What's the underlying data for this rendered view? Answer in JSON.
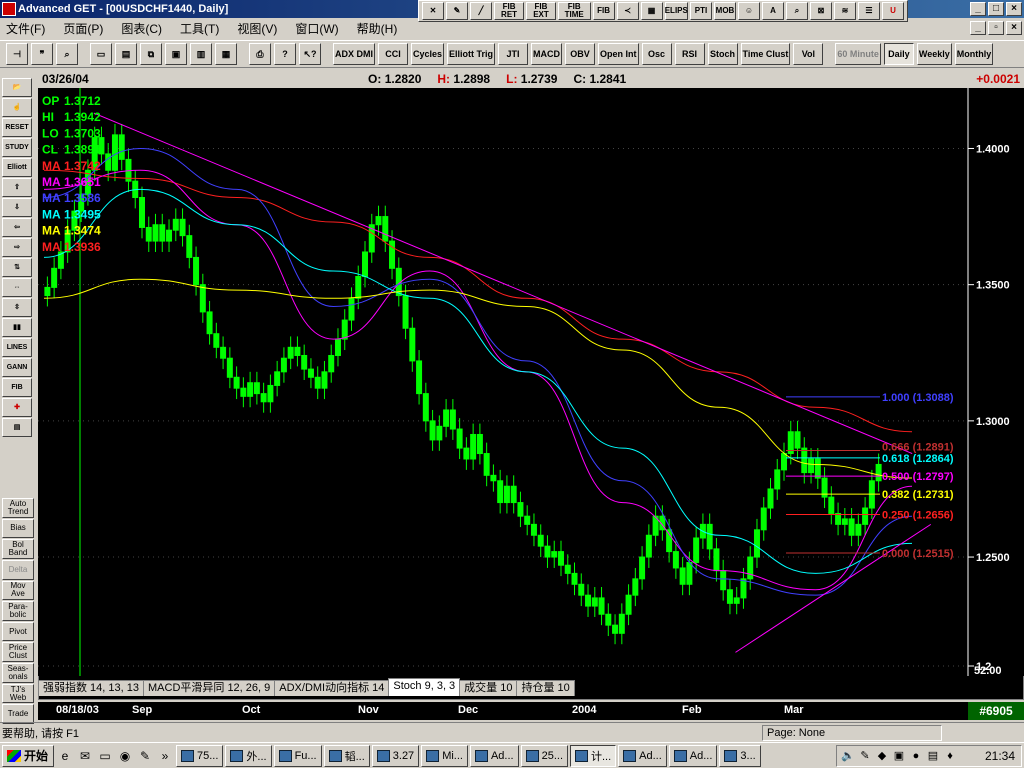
{
  "window": {
    "title": "Advanced GET - [00USDCHF1440, Daily]"
  },
  "menu": [
    "文件(F)",
    "页面(P)",
    "图表(C)",
    "工具(T)",
    "视图(V)",
    "窗口(W)",
    "帮助(H)"
  ],
  "floatbar": [
    "FIB RET",
    "FIB EXT",
    "FIB TIME",
    "FIB",
    "ELIPS",
    "PTI",
    "MOB",
    "A"
  ],
  "toolbar": {
    "studies": [
      "ADX DMI",
      "CCI",
      "Cycles",
      "Elliott Trig",
      "JTI",
      "MACD",
      "OBV",
      "Open Int",
      "Osc",
      "RSI",
      "Stoch",
      "Time Clust",
      "Vol"
    ],
    "periods": [
      "60 Minute",
      "Daily",
      "Weekly",
      "Monthly"
    ]
  },
  "palette": [
    "RESET",
    "STUDY",
    "Elliott",
    "LINES",
    "GANN",
    "FIB"
  ],
  "palette2": [
    "Auto Trend",
    "Bias",
    "Bol Band",
    "Delta",
    "Mov Ave",
    "Para-bolic",
    "Pivot",
    "Price Clust",
    "Seas-onals",
    "TJ's Web",
    "Trade"
  ],
  "info": {
    "date": "03/26/04",
    "o_label": "O:",
    "o": "1.2820",
    "h_label": "H:",
    "h": "1.2898",
    "l_label": "L:",
    "l": "1.2739",
    "c_label": "C:",
    "c": "1.2841",
    "change": "+0.0021"
  },
  "legend": [
    {
      "label": "OP",
      "value": "1.3712",
      "color": "#00ff00"
    },
    {
      "label": "HI",
      "value": "1.3942",
      "color": "#00ff00"
    },
    {
      "label": "LO",
      "value": "1.3703",
      "color": "#00ff00"
    },
    {
      "label": "CL",
      "value": "1.3891",
      "color": "#00ff00"
    },
    {
      "label": "MA",
      "value": "1.3742",
      "color": "#ff2020"
    },
    {
      "label": "MA",
      "value": "1.3651",
      "color": "#ff00ff"
    },
    {
      "label": "MA",
      "value": "1.3586",
      "color": "#4040ff"
    },
    {
      "label": "MA",
      "value": "1.3495",
      "color": "#00ffff"
    },
    {
      "label": "MA",
      "value": "1.3474",
      "color": "#ffff00"
    },
    {
      "label": "MA",
      "value": "1.3936",
      "color": "#ff2020"
    }
  ],
  "fib_levels": [
    {
      "ratio": "1.000",
      "price": 1.3088,
      "text": "1.000 (1.3088)",
      "color": "#4040ff"
    },
    {
      "ratio": "0.618",
      "price": 1.2864,
      "text": "0.618 (1.2864)",
      "color": "#00ffff"
    },
    {
      "ratio": "0.500",
      "price": 1.2797,
      "text": "0.500 (1.2797)",
      "color": "#ff00ff"
    },
    {
      "ratio": "0.382",
      "price": 1.2731,
      "text": "0.382 (1.2731)",
      "color": "#ffff00"
    },
    {
      "ratio": "0.250",
      "price": 1.2656,
      "text": "0.250 (1.2656)",
      "color": "#ff2020"
    },
    {
      "ratio": "0.000",
      "price": 1.2515,
      "text": "0.000 (1.2515)",
      "color": "#c03030"
    }
  ],
  "fib_extra": {
    "ratio": "0.666",
    "price": 1.2891,
    "text": "0.666 (1.2891)",
    "color": "#c03030"
  },
  "chart_data": {
    "type": "candlestick",
    "y_ticks": [
      "1.4000",
      "1.3500",
      "1.3000",
      "1.2500",
      "1.2"
    ],
    "y_tick_values": [
      1.4,
      1.35,
      1.3,
      1.25,
      1.21
    ],
    "ylim": [
      1.21,
      1.42
    ],
    "x_labels": [
      "08/18/03",
      "Sep",
      "Oct",
      "Nov",
      "Dec",
      "2004",
      "Feb",
      "Mar"
    ],
    "closes": [
      1.349,
      1.356,
      1.362,
      1.37,
      1.377,
      1.383,
      1.392,
      1.404,
      1.398,
      1.392,
      1.405,
      1.396,
      1.388,
      1.382,
      1.371,
      1.366,
      1.372,
      1.366,
      1.37,
      1.374,
      1.368,
      1.36,
      1.35,
      1.34,
      1.332,
      1.327,
      1.323,
      1.316,
      1.312,
      1.309,
      1.314,
      1.31,
      1.307,
      1.313,
      1.318,
      1.323,
      1.327,
      1.324,
      1.319,
      1.316,
      1.312,
      1.318,
      1.324,
      1.33,
      1.337,
      1.345,
      1.353,
      1.362,
      1.372,
      1.375,
      1.366,
      1.356,
      1.346,
      1.334,
      1.322,
      1.31,
      1.3,
      1.293,
      1.298,
      1.304,
      1.297,
      1.29,
      1.286,
      1.295,
      1.288,
      1.28,
      1.278,
      1.27,
      1.276,
      1.27,
      1.265,
      1.262,
      1.258,
      1.254,
      1.25,
      1.252,
      1.247,
      1.244,
      1.24,
      1.236,
      1.232,
      1.235,
      1.229,
      1.225,
      1.222,
      1.229,
      1.236,
      1.242,
      1.25,
      1.258,
      1.265,
      1.26,
      1.252,
      1.246,
      1.24,
      1.248,
      1.257,
      1.262,
      1.253,
      1.245,
      1.238,
      1.233,
      1.235,
      1.242,
      1.25,
      1.26,
      1.268,
      1.275,
      1.282,
      1.288,
      1.296,
      1.29,
      1.281,
      1.286,
      1.279,
      1.272,
      1.266,
      1.262,
      1.264,
      1.258,
      1.262,
      1.268,
      1.278,
      1.284
    ],
    "moving_averages": [
      {
        "color": "#ff2020",
        "values": [
          1.392,
          1.389,
          1.382,
          1.373,
          1.36,
          1.345,
          1.33,
          1.318,
          1.305,
          1.296
        ]
      },
      {
        "color": "#ff00ff",
        "values": [
          1.385,
          1.392,
          1.372,
          1.33,
          1.355,
          1.318,
          1.27,
          1.245,
          1.238,
          1.276
        ]
      },
      {
        "color": "#4040ff",
        "values": [
          1.382,
          1.4,
          1.385,
          1.342,
          1.352,
          1.322,
          1.278,
          1.242,
          1.236,
          1.265
        ]
      },
      {
        "color": "#00ffff",
        "values": [
          1.36,
          1.385,
          1.372,
          1.355,
          1.345,
          1.318,
          1.29,
          1.258,
          1.244,
          1.255
        ]
      },
      {
        "color": "#ffff00",
        "values": [
          1.345,
          1.352,
          1.348,
          1.345,
          1.348,
          1.342,
          1.326,
          1.305,
          1.284,
          1.279
        ]
      }
    ],
    "trendlines": [
      {
        "color": "#ff00ff",
        "from": [
          0.06,
          1.413
        ],
        "to": [
          0.94,
          1.288
        ]
      },
      {
        "color": "#ff00ff",
        "from": [
          0.75,
          1.215
        ],
        "to": [
          0.96,
          1.262
        ]
      }
    ]
  },
  "tabs": [
    "强弱指数 14, 13, 13",
    "MACD平滑异同 12, 26, 9",
    "ADX/DMI动向指标 14",
    "Stoch 9, 3, 3",
    "成交量 10",
    "持仓量 10"
  ],
  "osc_label": "52.00",
  "record": "#6905",
  "status": {
    "help": "要帮助, 请按 F1",
    "page": "Page: None"
  },
  "taskbar": {
    "start": "开始",
    "tasks": [
      "75...",
      "外...",
      "Fu...",
      "韬...",
      "3.27",
      "Mi...",
      "Ad...",
      "25...",
      "计...",
      "Ad...",
      "Ad...",
      "3..."
    ],
    "active": 8,
    "clock": "21:34"
  }
}
